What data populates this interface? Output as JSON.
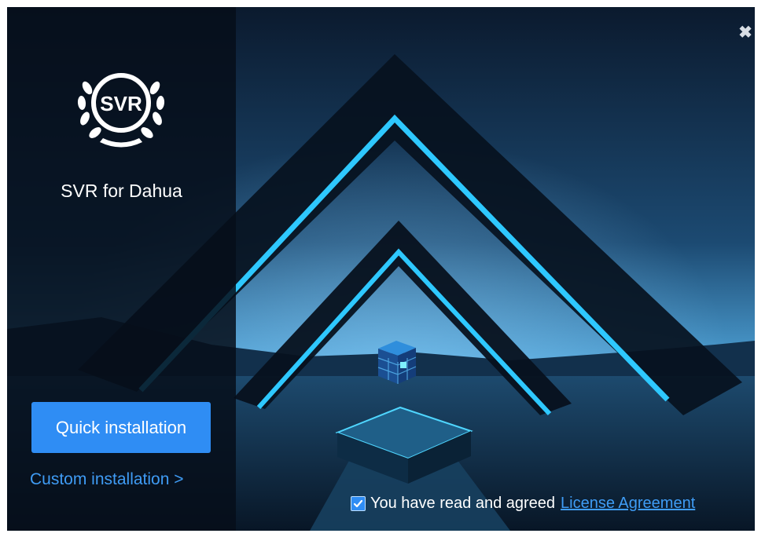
{
  "product": {
    "name": "SVR for Dahua",
    "logo_text": "SVR"
  },
  "actions": {
    "quick_install_label": "Quick installation",
    "custom_install_label": "Custom installation >"
  },
  "window": {
    "close_icon": "close-icon",
    "close_glyph": "✖"
  },
  "agreement": {
    "checked": true,
    "text": "You have read and agreed",
    "link_label": "License Agreement"
  },
  "colors": {
    "accent": "#2f8df4",
    "link": "#3f9cf5",
    "neon": "#2ec8ff",
    "panel": "#060e1a"
  }
}
